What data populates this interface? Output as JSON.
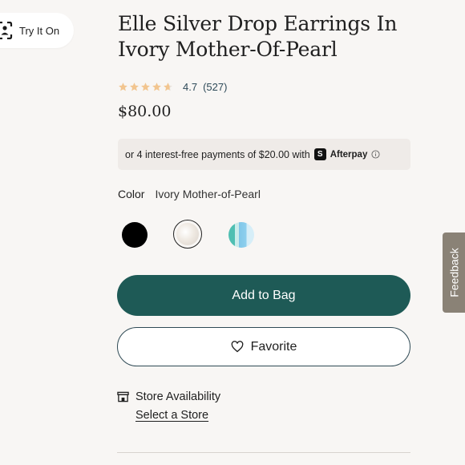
{
  "try_on": {
    "label": "Try It On",
    "icon": "face-scan-icon"
  },
  "product": {
    "title": "Elle Silver Drop Earrings In Ivory Mother-Of-Pearl",
    "rating": {
      "stars": 4.7,
      "value": "4.7",
      "count": "(527)",
      "star_color": "#f2c58f"
    },
    "price": "$80.00"
  },
  "afterpay": {
    "text": "or 4 interest-free payments of $20.00 with",
    "brand": "Afterpay",
    "icon": "info-icon"
  },
  "color": {
    "label": "Color",
    "selected": "Ivory Mother-of-Pearl",
    "swatches": [
      {
        "name": "Black",
        "color": "#000000"
      },
      {
        "name": "Ivory Mother-of-Pearl",
        "color": "#eee7e0",
        "selected": true
      },
      {
        "name": "Aqua",
        "color": "#4fbfb2"
      }
    ]
  },
  "actions": {
    "add_to_bag": "Add to Bag",
    "favorite": "Favorite",
    "primary_color": "#1e5a56"
  },
  "store": {
    "label": "Store Availability",
    "link": "Select a Store",
    "icon": "store-icon"
  },
  "feedback": {
    "label": "Feedback",
    "color": "#8a8276"
  }
}
